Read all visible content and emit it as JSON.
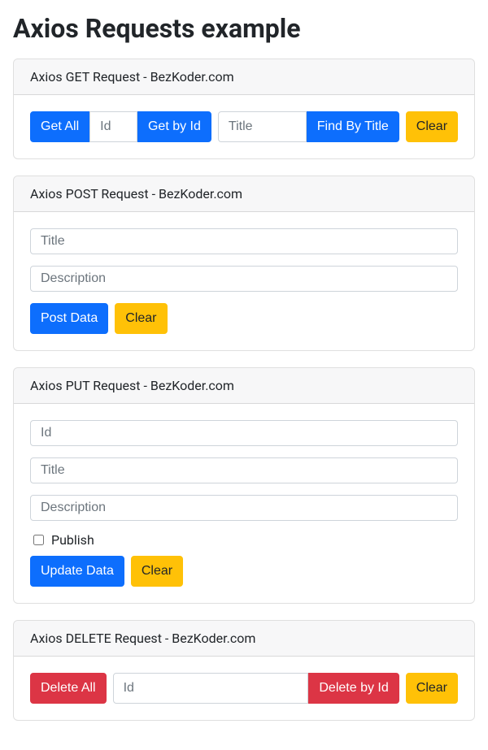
{
  "page": {
    "title": "Axios Requests example"
  },
  "cards": {
    "get": {
      "header": "Axios GET Request - BezKoder.com",
      "getAll": "Get All",
      "idPlaceholder": "Id",
      "getById": "Get by Id",
      "titlePlaceholder": "Title",
      "findByTitle": "Find By Title",
      "clear": "Clear"
    },
    "post": {
      "header": "Axios POST Request - BezKoder.com",
      "titlePlaceholder": "Title",
      "descPlaceholder": "Description",
      "postData": "Post Data",
      "clear": "Clear"
    },
    "put": {
      "header": "Axios PUT Request - BezKoder.com",
      "idPlaceholder": "Id",
      "titlePlaceholder": "Title",
      "descPlaceholder": "Description",
      "publishLabel": "Publish",
      "updateData": "Update Data",
      "clear": "Clear"
    },
    "delete": {
      "header": "Axios DELETE Request - BezKoder.com",
      "deleteAll": "Delete All",
      "idPlaceholder": "Id",
      "deleteById": "Delete by Id",
      "clear": "Clear"
    }
  }
}
